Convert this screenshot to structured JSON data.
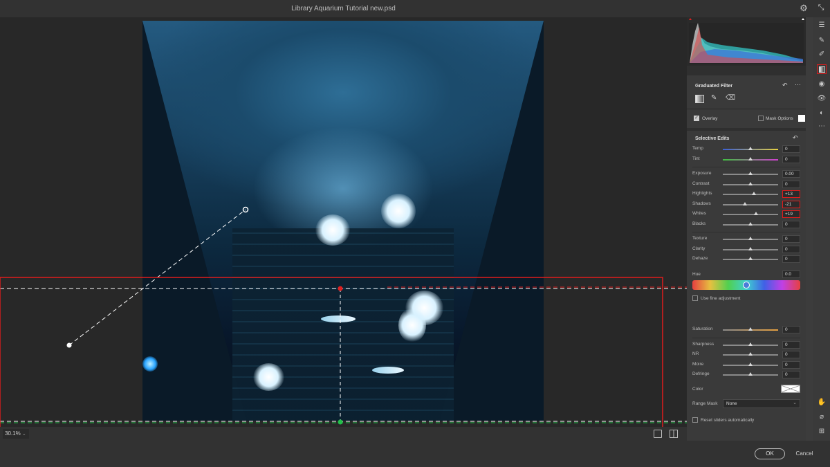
{
  "window": {
    "title": "Library Aquarium Tutorial new.psd"
  },
  "zoom": {
    "level": "30.1%"
  },
  "graduated_filter": {
    "title": "Graduated Filter",
    "overlay_label": "Overlay",
    "overlay_checked": true,
    "mask_options_label": "Mask Options",
    "mask_options_checked": false
  },
  "selective_edits": {
    "title": "Selective Edits",
    "groups": [
      [
        {
          "label": "Temp",
          "value": "0",
          "level": 0.5
        },
        {
          "label": "Tint",
          "value": "0",
          "level": 0.5
        }
      ],
      [
        {
          "label": "Exposure",
          "value": "0.00",
          "level": 0.5
        },
        {
          "label": "Contrast",
          "value": "0",
          "level": 0.5
        },
        {
          "label": "Highlights",
          "value": "+13",
          "level": 0.565,
          "highlighted": true
        },
        {
          "label": "Shadows",
          "value": "-21",
          "level": 0.395,
          "highlighted": true
        },
        {
          "label": "Whites",
          "value": "+19",
          "level": 0.595,
          "highlighted": true
        },
        {
          "label": "Blacks",
          "value": "0",
          "level": 0.5
        }
      ],
      [
        {
          "label": "Texture",
          "value": "0",
          "level": 0.5
        },
        {
          "label": "Clarity",
          "value": "0",
          "level": 0.5
        },
        {
          "label": "Dehaze",
          "value": "0",
          "level": 0.5
        }
      ]
    ],
    "hue": {
      "label": "Hue",
      "value": "0.0",
      "level": 0.5
    },
    "fine_adjustment_label": "Use fine adjustment",
    "groups2": [
      [
        {
          "label": "Saturation",
          "value": "0",
          "level": 0.5
        }
      ],
      [
        {
          "label": "Sharpness",
          "value": "0",
          "level": 0.5
        },
        {
          "label": "NR",
          "value": "0",
          "level": 0.5
        },
        {
          "label": "Moire",
          "value": "0",
          "level": 0.5
        },
        {
          "label": "Defringe",
          "value": "0",
          "level": 0.5
        }
      ]
    ],
    "color_label": "Color",
    "range_mask_label": "Range Mask",
    "range_mask_value": "None",
    "reset_label": "Reset sliders automatically"
  },
  "buttons": {
    "ok": "OK",
    "cancel": "Cancel"
  },
  "colors": {
    "highlight": "#e01c1c",
    "accent_green": "#22c04a",
    "accent_red": "#e02020"
  },
  "icons": [
    "gear-icon",
    "collapse-icon",
    "sliders-icon",
    "brush-icon",
    "pen-icon",
    "graduated-filter-icon",
    "radial-filter-icon",
    "red-eye-icon",
    "presets-icon",
    "more-icon",
    "hand-icon",
    "eyedropper-icon",
    "grid-icon"
  ]
}
